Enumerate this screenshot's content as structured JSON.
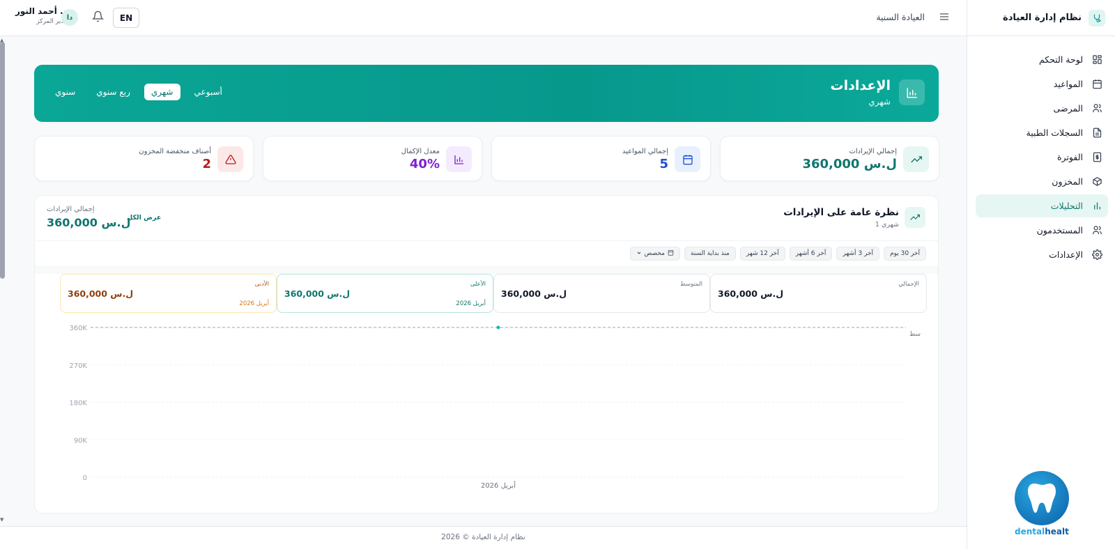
{
  "sidebar": {
    "brand": "نظام إدارة العيادة",
    "items": [
      {
        "label": "لوحة التحكم",
        "icon": "dashboard-icon"
      },
      {
        "label": "المواعيد",
        "icon": "calendar-icon"
      },
      {
        "label": "المرضى",
        "icon": "users-icon"
      },
      {
        "label": "السجلات الطبية",
        "icon": "document-icon"
      },
      {
        "label": "الفوترة",
        "icon": "dollar-icon"
      },
      {
        "label": "المخزون",
        "icon": "box-icon"
      },
      {
        "label": "التحليلات",
        "icon": "bar-chart-icon",
        "active": true
      },
      {
        "label": "المستخدمون",
        "icon": "users-icon"
      },
      {
        "label": "الإعدادات",
        "icon": "gear-icon"
      }
    ],
    "logo_text_1": "dental",
    "logo_text_2": "healt"
  },
  "topbar": {
    "title": "العيادة السنية",
    "user_name": "د. أحمد النور",
    "user_role": "مدير المركز",
    "avatar": "دا",
    "lang": "EN"
  },
  "hero": {
    "title": "الإعدادات",
    "subtitle": "شهري",
    "periods": [
      "أسبوعي",
      "شهري",
      "ربع سنوي",
      "سنوي"
    ],
    "active_period": "شهري"
  },
  "stats": [
    {
      "label": "إجمالي الإيرادات",
      "value": "ل.س 360,000",
      "color": "#0f766e",
      "icon_bg": "#e6f6f3",
      "icon": "trending-up-icon"
    },
    {
      "label": "إجمالي المواعيد",
      "value": "5",
      "color": "#1d4ed8",
      "icon_bg": "#e8f0fe",
      "icon": "calendar-icon"
    },
    {
      "label": "معدل الإكمال",
      "value": "40%",
      "color": "#7e22ce",
      "icon_bg": "#f5ebfe",
      "icon": "bar-chart-icon"
    },
    {
      "label": "أصناف منخفضة المخزون",
      "value": "2",
      "color": "#b91c1c",
      "icon_bg": "#fde8e8",
      "icon": "warning-icon"
    }
  ],
  "revenue_card": {
    "title": "نظرة عامة على الإيرادات",
    "subtitle": "1 شهري",
    "total_label": "إجمالي الإيرادات",
    "total_value": "ل.س 360,000",
    "view_all": "عرض الكل",
    "filters": [
      "آخر 30 يوم",
      "آخر 3 أشهر",
      "آخر 6 أشهر",
      "آخر 12 شهر",
      "منذ بداية السنة",
      "مخصص"
    ],
    "summary": [
      {
        "label": "الإجمالي",
        "value": "ل.س 360,000",
        "date": ""
      },
      {
        "label": "المتوسط",
        "value": "ل.س 360,000",
        "date": ""
      },
      {
        "label": "الأعلى",
        "value": "ل.س 360,000",
        "date": "أبريل 2026"
      },
      {
        "label": "الأدنى",
        "value": "ل.س 360,000",
        "date": "أبريل 2026"
      }
    ],
    "avg_label": "سط"
  },
  "chart_data": {
    "type": "line",
    "categories": [
      "أبريل 2026"
    ],
    "series": [
      {
        "values": [
          360000
        ]
      }
    ],
    "yticks": [
      "0",
      "90K",
      "180K",
      "270K",
      "360K"
    ],
    "ylim": [
      0,
      360000
    ],
    "grid": true
  },
  "footer": {
    "text": "نظام إدارة العيادة © 2026"
  }
}
